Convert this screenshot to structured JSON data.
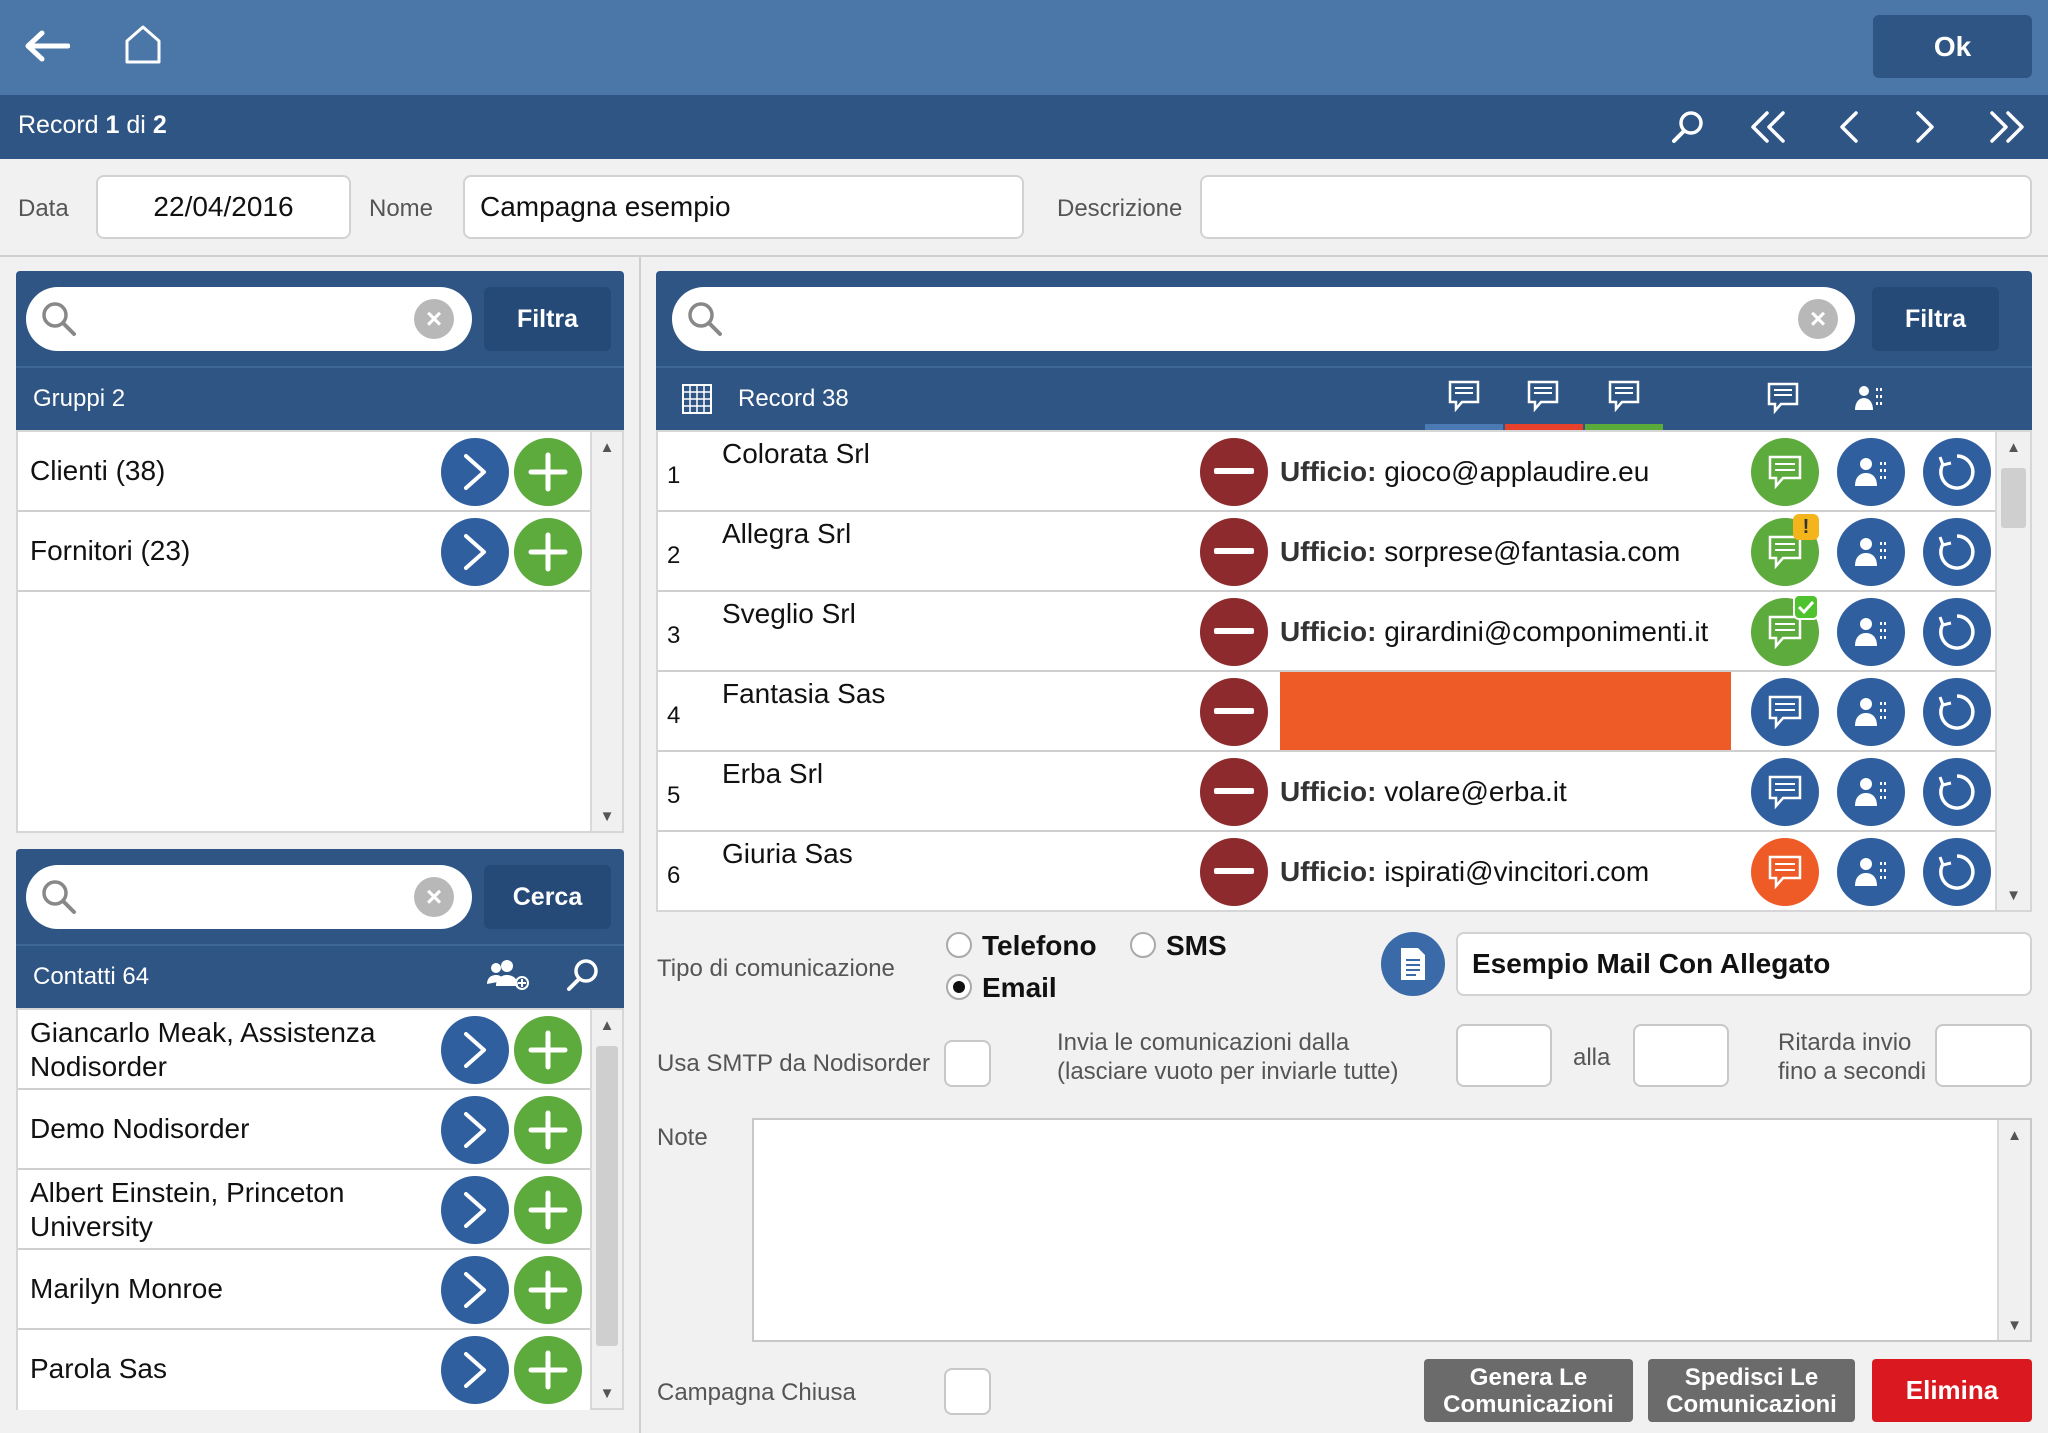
{
  "toolbar": {
    "ok_label": "Ok",
    "back_icon": "arrow-left-icon",
    "home_icon": "home-icon"
  },
  "record_bar": {
    "prefix": "Record",
    "current": "1",
    "sep": "di",
    "total": "2"
  },
  "form": {
    "data_label": "Data",
    "data_value": "22/04/2016",
    "nome_label": "Nome",
    "nome_value": "Campagna esempio",
    "descrizione_label": "Descrizione",
    "descrizione_value": ""
  },
  "groups": {
    "filter_label": "Filtra",
    "header": "Gruppi 2",
    "items": [
      {
        "label": "Clienti (38)"
      },
      {
        "label": "Fornitori (23)"
      }
    ]
  },
  "contacts": {
    "search_label": "Cerca",
    "header": "Contatti 64",
    "items": [
      {
        "label": "Giancarlo Meak, Assistenza Nodisorder"
      },
      {
        "label": "Demo Nodisorder"
      },
      {
        "label": "Albert Einstein, Princeton University"
      },
      {
        "label": "Marilyn Monroe"
      },
      {
        "label": "Parola Sas"
      }
    ]
  },
  "grid": {
    "filter_label": "Filtra",
    "header": "Record 38",
    "tab_colors": [
      "#4a79b4",
      "#e8412b",
      "#5aab3a"
    ],
    "rows": [
      {
        "num": "1",
        "name": "Colorata Srl",
        "email_label": "Ufficio:",
        "email": "gioco@applaudire.eu",
        "msg_color": "#5cab3c",
        "badge": ""
      },
      {
        "num": "2",
        "name": "Allegra Srl",
        "email_label": "Ufficio:",
        "email": "sorprese@fantasia.com",
        "msg_color": "#5cab3c",
        "badge": "warning"
      },
      {
        "num": "3",
        "name": "Sveglio Srl",
        "email_label": "Ufficio:",
        "email": "girardini@componimenti.it",
        "msg_color": "#5cab3c",
        "badge": "check"
      },
      {
        "num": "4",
        "name": "Fantasia Sas",
        "email_label": "",
        "email": "",
        "msg_color": "#2f5f9e",
        "badge": "",
        "highlight": "#ee5b27"
      },
      {
        "num": "5",
        "name": "Erba Srl",
        "email_label": "Ufficio:",
        "email": "volare@erba.it",
        "msg_color": "#2f5f9e",
        "badge": ""
      },
      {
        "num": "6",
        "name": "Giuria Sas",
        "email_label": "Ufficio:",
        "email": "ispirati@vincitori.com",
        "msg_color": "#ee5b27",
        "badge": ""
      }
    ]
  },
  "comm": {
    "tipo_label": "Tipo di comunicazione",
    "options": [
      {
        "label": "Telefono",
        "selected": false
      },
      {
        "label": "SMS",
        "selected": false
      },
      {
        "label": "Email",
        "selected": true
      }
    ],
    "template_value": "Esempio Mail Con Allegato",
    "smtp_label": "Usa SMTP da Nodisorder",
    "invia_label_1": "Invia le comunicazioni dalla",
    "invia_label_2": "(lasciare vuoto per inviarle tutte)",
    "alla_label": "alla",
    "ritarda_label_1": "Ritarda invio",
    "ritarda_label_2": "fino a secondi",
    "note_label": "Note",
    "chiusa_label": "Campagna Chiusa"
  },
  "actions": {
    "genera_1": "Genera Le",
    "genera_2": "Comunicazioni",
    "spedisci_1": "Spedisci Le",
    "spedisci_2": "Comunicazioni",
    "elimina": "Elimina"
  }
}
